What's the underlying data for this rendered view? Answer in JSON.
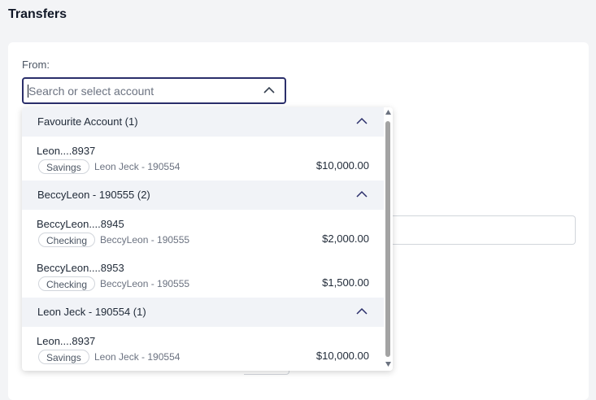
{
  "page": {
    "title": "Transfers"
  },
  "from": {
    "label": "From:",
    "search_placeholder": "Search or select account",
    "search_value": ""
  },
  "dropdown": {
    "groups": [
      {
        "title": "Favourite Account (1)",
        "accounts": [
          {
            "name": "Leon....8937",
            "type": "Savings",
            "owner": "Leon Jeck - 190554",
            "amount": "$10,000.00"
          }
        ]
      },
      {
        "title": "BeccyLeon - 190555 (2)",
        "accounts": [
          {
            "name": "BeccyLeon....8945",
            "type": "Checking",
            "owner": "BeccyLeon - 190555",
            "amount": "$2,000.00"
          },
          {
            "name": "BeccyLeon....8953",
            "type": "Checking",
            "owner": "BeccyLeon - 190555",
            "amount": "$1,500.00"
          }
        ]
      },
      {
        "title": "Leon Jeck - 190554 (1)",
        "accounts": [
          {
            "name": "Leon....8937",
            "type": "Savings",
            "owner": "Leon Jeck - 190554",
            "amount": "$10,000.00"
          }
        ]
      }
    ]
  },
  "colors": {
    "accent": "#2b2f6b",
    "group_header_bg": "#f1f3f7",
    "page_bg": "#f3f4f6"
  },
  "icons": {
    "search_toggle": "chevron-up-icon",
    "group_toggle": "chevron-up-icon"
  }
}
